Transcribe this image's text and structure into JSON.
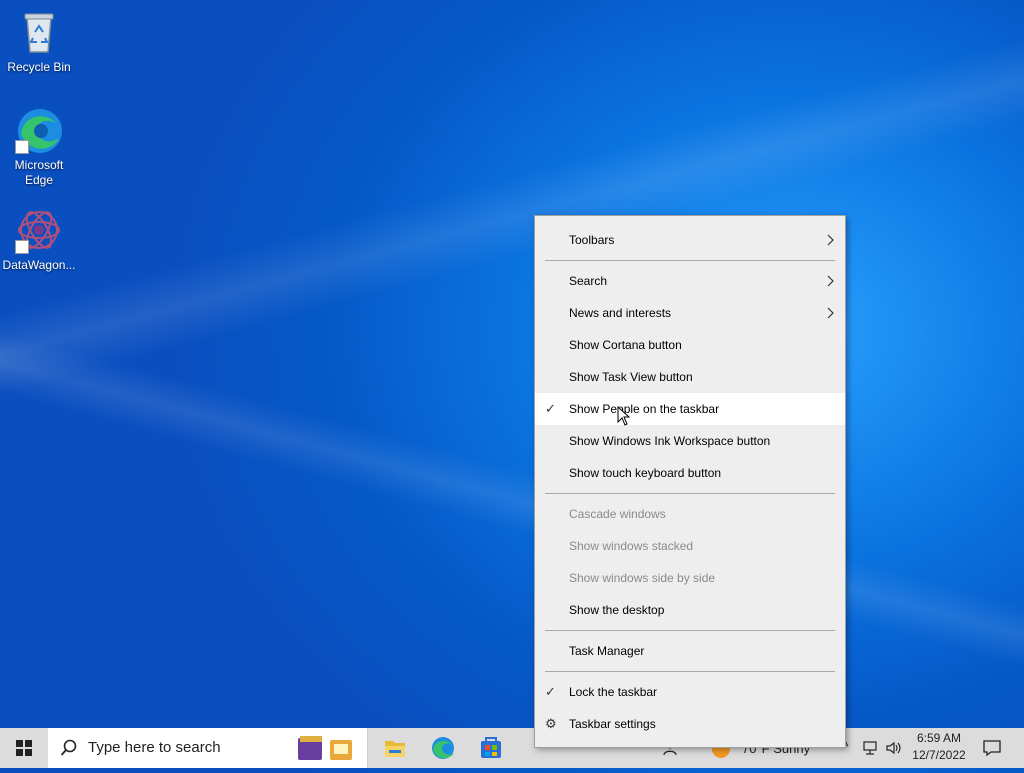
{
  "desktop": {
    "icons": [
      {
        "label": "Recycle Bin",
        "icon": "recycle-bin-icon"
      },
      {
        "label": "Microsoft Edge",
        "icon": "edge-icon"
      },
      {
        "label": "DataWagon...",
        "icon": "datawagon-icon"
      }
    ]
  },
  "context_menu": {
    "items": [
      {
        "label": "Toolbars",
        "submenu": true
      },
      {
        "label": "Search",
        "submenu": true
      },
      {
        "label": "News and interests",
        "submenu": true
      },
      {
        "label": "Show Cortana button"
      },
      {
        "label": "Show Task View button"
      },
      {
        "label": "Show People on the taskbar",
        "checked": true,
        "highlighted": true
      },
      {
        "label": "Show Windows Ink Workspace button"
      },
      {
        "label": "Show touch keyboard button"
      },
      {
        "label": "Cascade windows",
        "disabled": true
      },
      {
        "label": "Show windows stacked",
        "disabled": true
      },
      {
        "label": "Show windows side by side",
        "disabled": true
      },
      {
        "label": "Show the desktop"
      },
      {
        "label": "Task Manager"
      },
      {
        "label": "Lock the taskbar",
        "checked": true
      },
      {
        "label": "Taskbar settings",
        "icon": "gear-icon"
      }
    ]
  },
  "taskbar": {
    "search_placeholder": "Type here to search",
    "weather": "70°F  Sunny",
    "time": "6:59 AM",
    "date": "12/7/2022",
    "pinned": [
      "file-explorer-icon",
      "edge-icon",
      "store-icon"
    ]
  },
  "colors": {
    "desktop_accent": "#0a73e0",
    "menu_bg": "#eeeeee",
    "taskbar_bg": "#dcdcdc"
  }
}
